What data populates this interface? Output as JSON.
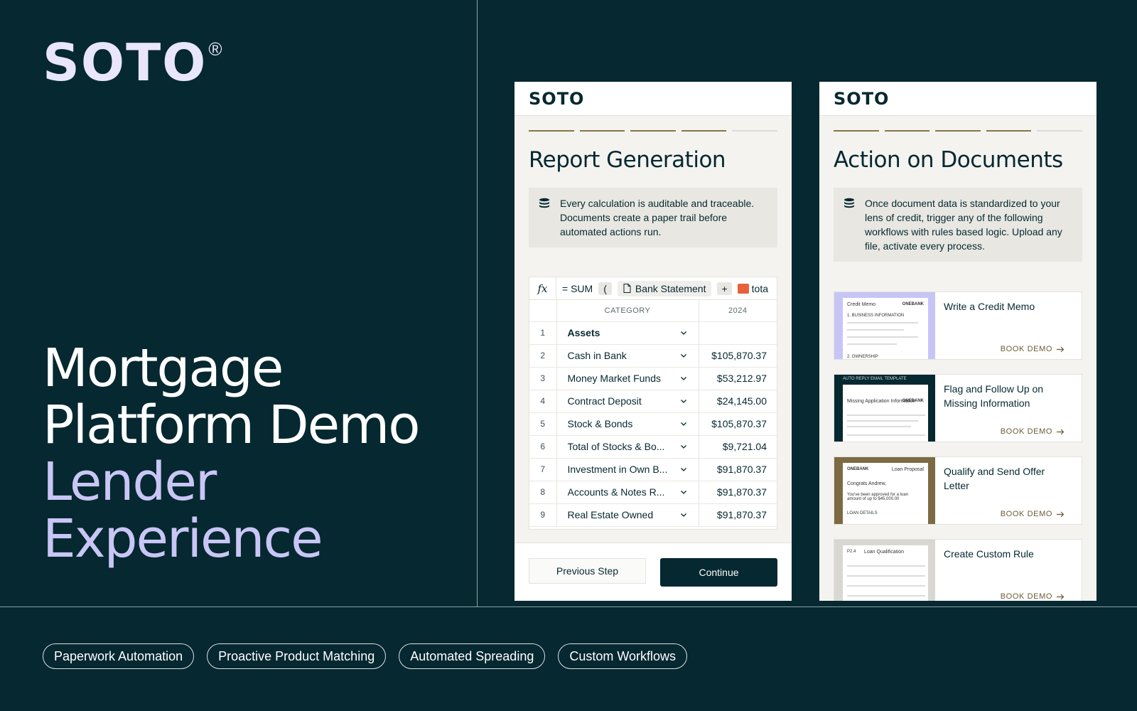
{
  "brand": {
    "logo": "SOTO",
    "reg": "®"
  },
  "headline": {
    "line1": "Mortgage",
    "line2": "Platform Demo",
    "line3": "Lender",
    "line4": "Experience"
  },
  "pills": [
    "Paperwork Automation",
    "Proactive Product Matching",
    "Automated Spreading",
    "Custom Workflows"
  ],
  "card1": {
    "logo": "SOTO",
    "title": "Report Generation",
    "info": "Every calculation is auditable and traceable. Documents create a paper trail before automated actions run.",
    "formula": {
      "fx": "fx",
      "sum": "= SUM",
      "paren": "(",
      "chip": "Bank Statement",
      "plus": "+",
      "tag": "tota"
    },
    "headers": {
      "category": "CATEGORY",
      "year": "2024"
    },
    "rows": [
      {
        "n": "1",
        "cat": "Assets",
        "val": ""
      },
      {
        "n": "2",
        "cat": "Cash in Bank",
        "val": "$105,870.37"
      },
      {
        "n": "3",
        "cat": "Money Market Funds",
        "val": "$53,212.97"
      },
      {
        "n": "4",
        "cat": "Contract Deposit",
        "val": "$24,145.00"
      },
      {
        "n": "5",
        "cat": "Stock & Bonds",
        "val": "$105,870.37"
      },
      {
        "n": "6",
        "cat": "Total of Stocks & Bo...",
        "val": "$9,721.04"
      },
      {
        "n": "7",
        "cat": "Investment in Own B...",
        "val": "$91,870.37"
      },
      {
        "n": "8",
        "cat": "Accounts & Notes R...",
        "val": "$91,870.37"
      },
      {
        "n": "9",
        "cat": "Real Estate Owned",
        "val": "$91,870.37"
      }
    ],
    "prev_label": "Previous Step",
    "continue_label": "Continue"
  },
  "card2": {
    "logo": "SOTO",
    "title": "Action on Documents",
    "info": "Once document data is standardized to your lens of credit, trigger any of the following workflows with rules based logic. Upload any file, activate every process.",
    "actions": [
      {
        "title": "Write a Credit Memo",
        "book": "BOOK DEMO",
        "thumb": {
          "head": "Credit Memo",
          "bank": "ONEBANK",
          "sub": "1. BUSINESS INFORMATION",
          "foot": "2. OWNERSHIP"
        }
      },
      {
        "title": "Flag and Follow Up on Missing Information",
        "book": "BOOK DEMO",
        "thumb": {
          "head": "AUTO REPLY EMAIL TEMPLATE",
          "bank": "ONEBANK",
          "sub": "Missing Application Information"
        }
      },
      {
        "title": "Qualify and Send Offer Letter",
        "book": "BOOK DEMO",
        "thumb": {
          "head": "Loan Proposal",
          "bank": "ONEBANK",
          "sub": "Congrats Andrew,",
          "body": "You've been approved for a loan amount of up to $45,000.00",
          "foot": "LOAN DETAILS"
        }
      },
      {
        "title": "Create Custom Rule",
        "book": "BOOK DEMO",
        "thumb": {
          "head": "Loan Qualification",
          "code": "P2.4"
        }
      }
    ]
  },
  "colors": {
    "background": "#062830",
    "accent_lavender": "#c9c6f6",
    "step_gold": "#8a7444",
    "tag_orange": "#e8613d"
  }
}
